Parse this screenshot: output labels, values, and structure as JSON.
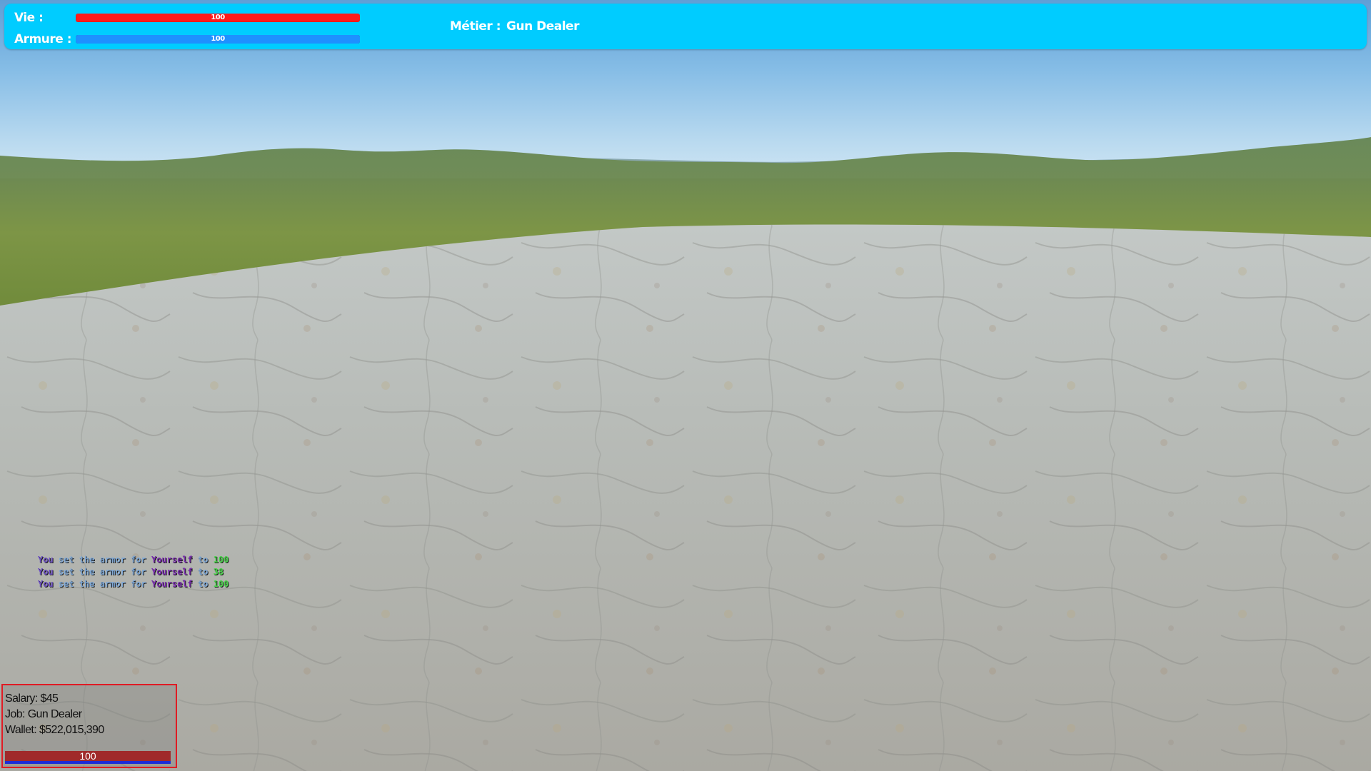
{
  "hud": {
    "health": {
      "label": "Vie :",
      "value": "100",
      "fraction": 1.0,
      "color": "#ff1a1a"
    },
    "armor": {
      "label": "Armure :",
      "value": "100",
      "fraction": 1.0,
      "color": "#1e90ff"
    },
    "job": {
      "label": "Métier :",
      "value": "Gun Dealer"
    },
    "background_color": "#00ccff"
  },
  "chat": {
    "lines": [
      {
        "actor": "You",
        "text": " set the armor for ",
        "target": "Yourself",
        "to": " to ",
        "value": "100"
      },
      {
        "actor": "You",
        "text": " set the armor for ",
        "target": "Yourself",
        "to": " to ",
        "value": "38"
      },
      {
        "actor": "You",
        "text": " set the armor for ",
        "target": "Yourself",
        "to": " to ",
        "value": "100"
      }
    ]
  },
  "info_box": {
    "salary": "Salary: $45",
    "job": "Job: Gun Dealer",
    "wallet": "Wallet: $522,015,390",
    "health_value": "100",
    "health_fraction": 1.0,
    "border_color": "#e01b24"
  }
}
